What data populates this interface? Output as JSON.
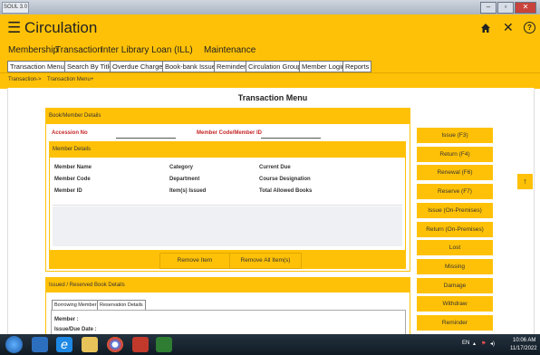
{
  "window": {
    "title": "SOUL 3.0"
  },
  "app": {
    "title": "Circulation"
  },
  "menu": [
    "Membership",
    "Transaction",
    "Inter Library Loan (ILL)",
    "Maintenance"
  ],
  "tabs": [
    "Transaction Menu",
    "Search By Title",
    "Overdue Charges",
    "Book-bank Issue",
    "Reminder",
    "Circulation Group",
    "Member Login",
    "Reports"
  ],
  "breadcrumb": {
    "first": "Transaction",
    "sep1": "->",
    "second": "Transaction Menu",
    "sep2": "+"
  },
  "page": {
    "title": "Transaction Menu"
  },
  "book_member": {
    "header": "Book/Member Details",
    "accession_label": "Accession No",
    "member_code_label": "Member Code/Member ID",
    "member_details_header": "Member Details",
    "fields": {
      "member_name": "Member Name",
      "category": "Category",
      "current_due": "Current Due",
      "member_code": "Member Code",
      "department": "Department",
      "course_designation": "Course Designation",
      "member_id": "Member ID",
      "items_issued": "Item(s) Issued",
      "total_allowed": "Total Allowed Books"
    },
    "remove_item": "Remove Item",
    "remove_all": "Remove All Item(s)"
  },
  "issued": {
    "header": "Issued / Reserved Book Details",
    "tab_borrowing": "Borrowing Member",
    "tab_reservation": "Reservation Details",
    "member_label": "Member :",
    "issue_due_label": "Issue/Due Date :"
  },
  "side_buttons": [
    "Issue (F3)",
    "Return (F4)",
    "Renewal (F6)",
    "Reserve (F7)",
    "Issue (On-Premises)",
    "Return (On-Premises)",
    "Lost",
    "Missing",
    "Damage",
    "Withdraw",
    "Reminder"
  ],
  "taskbar": {
    "lang": "EN",
    "time": "10:06 AM",
    "date": "11/17/2022"
  }
}
